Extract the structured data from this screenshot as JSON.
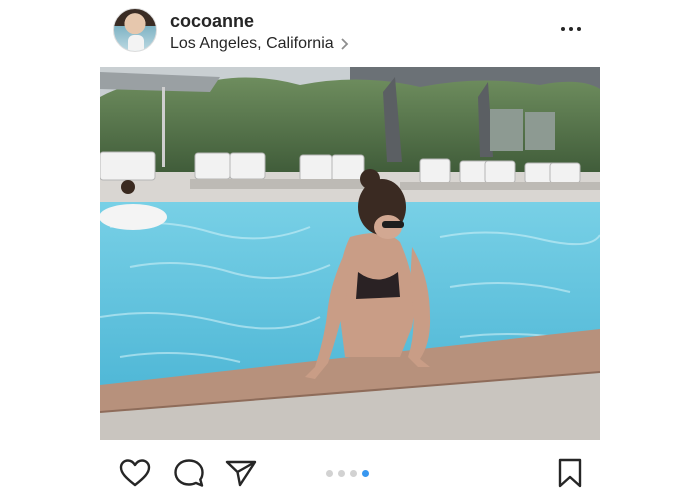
{
  "post": {
    "username": "cocoanne",
    "location": "Los Angeles, California"
  },
  "icons": {
    "avatar": "profile-photo",
    "location_arrow": "chevron-right-icon",
    "more": "more-dots-icon",
    "like": "heart-icon",
    "comment": "comment-bubble-icon",
    "share": "paper-plane-icon",
    "save": "bookmark-icon"
  },
  "carousel": {
    "total": 4,
    "active_index": 3
  },
  "colors": {
    "text": "#262626",
    "dot_inactive": "#d2d2d2",
    "dot_active": "#3897f0",
    "pool_water": "#5ec6df",
    "pool_deck": "#b88f7a"
  }
}
